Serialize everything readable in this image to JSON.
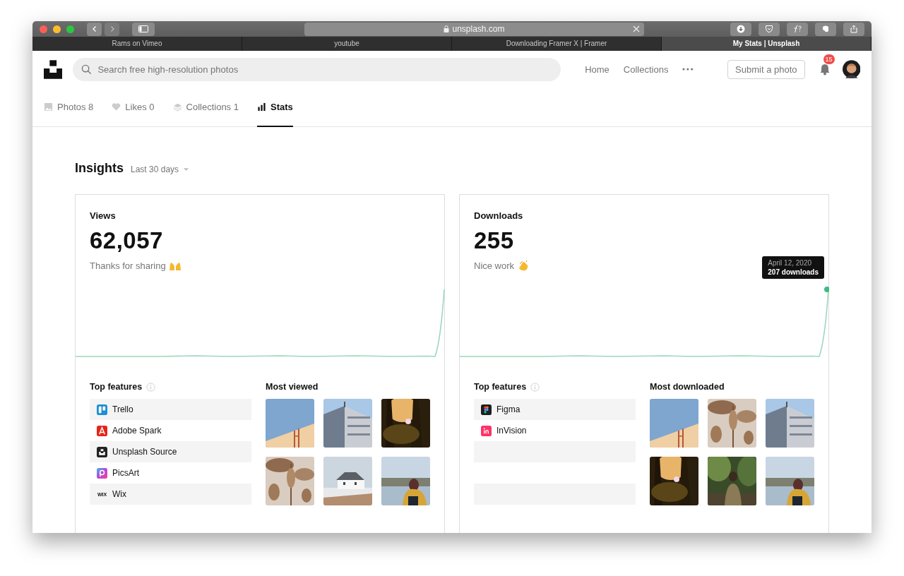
{
  "browser": {
    "address": "unsplash.com",
    "tabs": [
      {
        "label": "Rams on Vimeo",
        "selected": false
      },
      {
        "label": "youtube",
        "selected": false
      },
      {
        "label": "Downloading Framer X | Framer",
        "selected": false
      },
      {
        "label": "My Stats | Unsplash",
        "selected": true
      }
    ]
  },
  "header": {
    "search": {
      "placeholder": "Search free high-resolution photos"
    },
    "nav": [
      "Home",
      "Collections"
    ],
    "submit": "Submit a photo",
    "notifications": "15"
  },
  "profile_tabs": [
    {
      "label": "Photos 8",
      "kind": "photos",
      "selected": false
    },
    {
      "label": "Likes 0",
      "kind": "likes",
      "selected": false
    },
    {
      "label": "Collections 1",
      "kind": "collections",
      "selected": false
    },
    {
      "label": "Stats",
      "kind": "stats",
      "selected": true
    }
  ],
  "insights": {
    "title": "Insights",
    "period": "Last 30 days"
  },
  "cards": [
    {
      "label": "Views",
      "value": "62,057",
      "message": "Thanks for sharing",
      "features_title": "Top features",
      "features": [
        {
          "name": "Trello",
          "kind": "trello"
        },
        {
          "name": "Adobe Spark",
          "kind": "adobe"
        },
        {
          "name": "Unsplash Source",
          "kind": "unsplash"
        },
        {
          "name": "PicsArt",
          "kind": "picsart"
        },
        {
          "name": "Wix",
          "kind": "wix",
          "logo_text": "WIX"
        }
      ],
      "photos_title": "Most viewed",
      "photos": [
        {
          "kind": "picture"
        },
        {
          "kind": "picture"
        },
        {
          "kind": "picture"
        },
        {
          "kind": "picture"
        },
        {
          "kind": "picture"
        },
        {
          "kind": "picture"
        }
      ]
    },
    {
      "label": "Downloads",
      "value": "255",
      "message": "Nice work",
      "tooltip": {
        "date": "April 12, 2020",
        "value": "207 downloads"
      },
      "features_title": "Top features",
      "features": [
        {
          "name": "Figma",
          "kind": "figma"
        },
        {
          "name": "InVision",
          "kind": "invision"
        }
      ],
      "photos_title": "Most downloaded",
      "photos": [
        {
          "kind": "picture"
        },
        {
          "kind": "picture"
        },
        {
          "kind": "picture"
        },
        {
          "kind": "picture"
        },
        {
          "kind": "picture"
        },
        {
          "kind": "picture"
        }
      ]
    }
  ]
}
